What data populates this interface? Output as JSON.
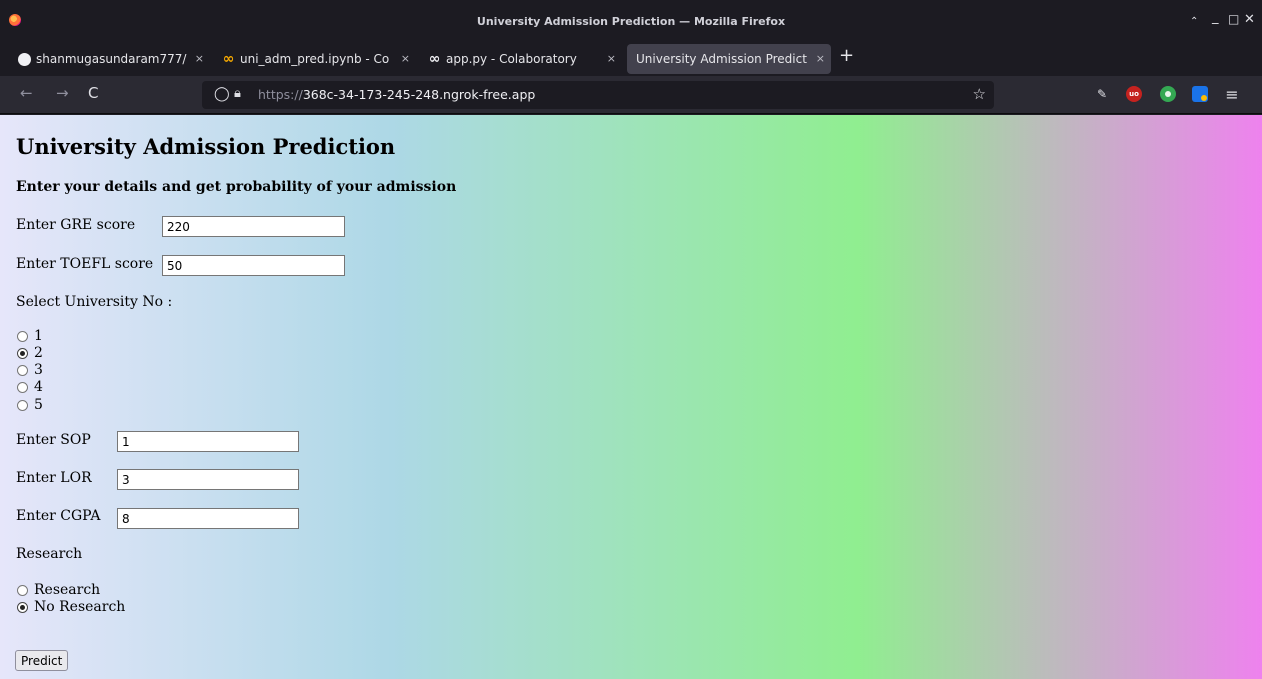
{
  "window": {
    "title": "University Admission Prediction — Mozilla Firefox",
    "controls": {
      "minimize": "_",
      "maximize": "□",
      "close": "✕",
      "collapse": "⌃"
    }
  },
  "tabs": [
    {
      "label": "shanmugasundaram777/",
      "icon": "github-icon",
      "close": "×",
      "active": false
    },
    {
      "label": "uni_adm_pred.ipynb - Co",
      "icon": "colab-icon",
      "close": "×",
      "active": false
    },
    {
      "label": "app.py - Colaboratory",
      "icon": "colab-icon",
      "close": "×",
      "active": false
    },
    {
      "label": "University Admission Predict",
      "icon": "none",
      "close": "×",
      "active": true
    }
  ],
  "new_tab": "+",
  "nav": {
    "back": "←",
    "forward": "→",
    "reload": "C",
    "url_scheme": "https://",
    "url_host": "368c-34-173-245-248.ngrok-free.app",
    "star": "☆",
    "menu": "≡",
    "extensions": [
      "reader-icon",
      "ublock-icon",
      "sync-icon",
      "extension-icon"
    ],
    "ublock_text": "uo"
  },
  "page": {
    "title": "University Admission Prediction",
    "subtitle": "Enter your details and get probability of your admission",
    "gre_label": "Enter GRE score",
    "gre_value": "220",
    "toefl_label": "Enter TOEFL score",
    "toefl_value": "50",
    "university_label": "Select University No :",
    "universities": [
      {
        "label": "1",
        "checked": false
      },
      {
        "label": "2",
        "checked": true
      },
      {
        "label": "3",
        "checked": false
      },
      {
        "label": "4",
        "checked": false
      },
      {
        "label": "5",
        "checked": false
      }
    ],
    "sop_label": "Enter SOP",
    "sop_value": "1",
    "lor_label": "Enter LOR",
    "lor_value": "3",
    "cgpa_label": "Enter CGPA",
    "cgpa_value": "8",
    "research_label": "Research",
    "research_options": [
      {
        "label": "Research",
        "checked": false
      },
      {
        "label": "No Research",
        "checked": true
      }
    ],
    "predict_label": "Predict"
  },
  "colors": {
    "gradient": [
      "#e6e6fa",
      "#add8e6",
      "#90ee90",
      "#ee82ee"
    ],
    "chrome_dark": "#1c1b22",
    "toolbar": "#2b2a33"
  }
}
